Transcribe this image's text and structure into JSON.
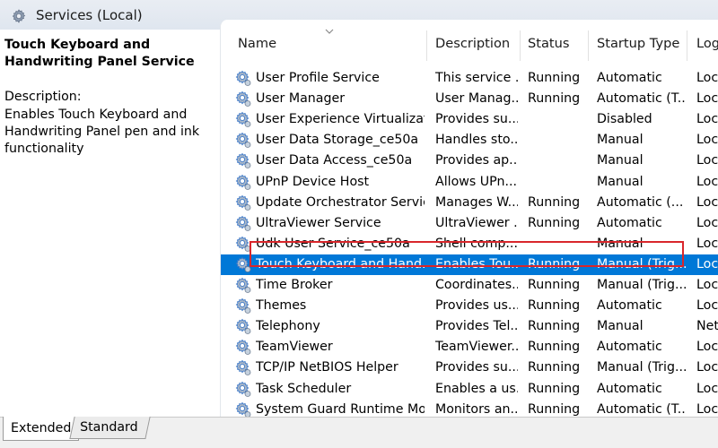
{
  "header": {
    "title": "Services (Local)"
  },
  "left_pane": {
    "service_title": "Touch Keyboard and Handwriting Panel Service",
    "description_label": "Description:",
    "description_text": "Enables Touch Keyboard and Handwriting Panel pen and ink functionality"
  },
  "columns": {
    "name": "Name",
    "description": "Description",
    "status": "Status",
    "startup_type": "Startup Type",
    "log_on_as": "Log"
  },
  "rows": [
    {
      "name": "User Profile Service",
      "description": "This service ...",
      "status": "Running",
      "startup": "Automatic",
      "logon": "Loc"
    },
    {
      "name": "User Manager",
      "description": "User Manag...",
      "status": "Running",
      "startup": "Automatic (T...",
      "logon": "Loc"
    },
    {
      "name": "User Experience Virtualizati...",
      "description": "Provides su...",
      "status": "",
      "startup": "Disabled",
      "logon": "Loc"
    },
    {
      "name": "User Data Storage_ce50a",
      "description": "Handles sto...",
      "status": "",
      "startup": "Manual",
      "logon": "Loc"
    },
    {
      "name": "User Data Access_ce50a",
      "description": "Provides ap...",
      "status": "",
      "startup": "Manual",
      "logon": "Loc"
    },
    {
      "name": "UPnP Device Host",
      "description": "Allows UPn...",
      "status": "",
      "startup": "Manual",
      "logon": "Loc"
    },
    {
      "name": "Update Orchestrator Service",
      "description": "Manages W...",
      "status": "Running",
      "startup": "Automatic (...",
      "logon": "Loc"
    },
    {
      "name": "UltraViewer Service",
      "description": "UltraViewer ...",
      "status": "Running",
      "startup": "Automatic",
      "logon": "Loc"
    },
    {
      "name": "Udk User Service_ce50a",
      "description": "Shell comp...",
      "status": "",
      "startup": "Manual",
      "logon": "Loc"
    },
    {
      "name": "Touch Keyboard and Hand...",
      "description": "Enables Tou...",
      "status": "Running",
      "startup": "Manual (Trig...",
      "logon": "Loc"
    },
    {
      "name": "Time Broker",
      "description": "Coordinates...",
      "status": "Running",
      "startup": "Manual (Trig...",
      "logon": "Loc"
    },
    {
      "name": "Themes",
      "description": "Provides us...",
      "status": "Running",
      "startup": "Automatic",
      "logon": "Loc"
    },
    {
      "name": "Telephony",
      "description": "Provides Tel...",
      "status": "Running",
      "startup": "Manual",
      "logon": "Net"
    },
    {
      "name": "TeamViewer",
      "description": "TeamViewer...",
      "status": "Running",
      "startup": "Automatic",
      "logon": "Loc"
    },
    {
      "name": "TCP/IP NetBIOS Helper",
      "description": "Provides su...",
      "status": "Running",
      "startup": "Manual (Trig...",
      "logon": "Loc"
    },
    {
      "name": "Task Scheduler",
      "description": "Enables a us...",
      "status": "Running",
      "startup": "Automatic",
      "logon": "Loc"
    },
    {
      "name": "System Guard Runtime Mo...",
      "description": "Monitors an...",
      "status": "Running",
      "startup": "Automatic (T...",
      "logon": "Loc"
    }
  ],
  "selected_row": 9,
  "tabs": {
    "extended": "Extended",
    "standard": "Standard"
  },
  "colors": {
    "selection": "#0078d7",
    "highlight_box": "#d9262b",
    "gear_blue": "#3c78c8"
  },
  "icons": {
    "header": "services-gear-icon",
    "row": "service-gear-icon",
    "sort": "sort-chevron-icon"
  }
}
